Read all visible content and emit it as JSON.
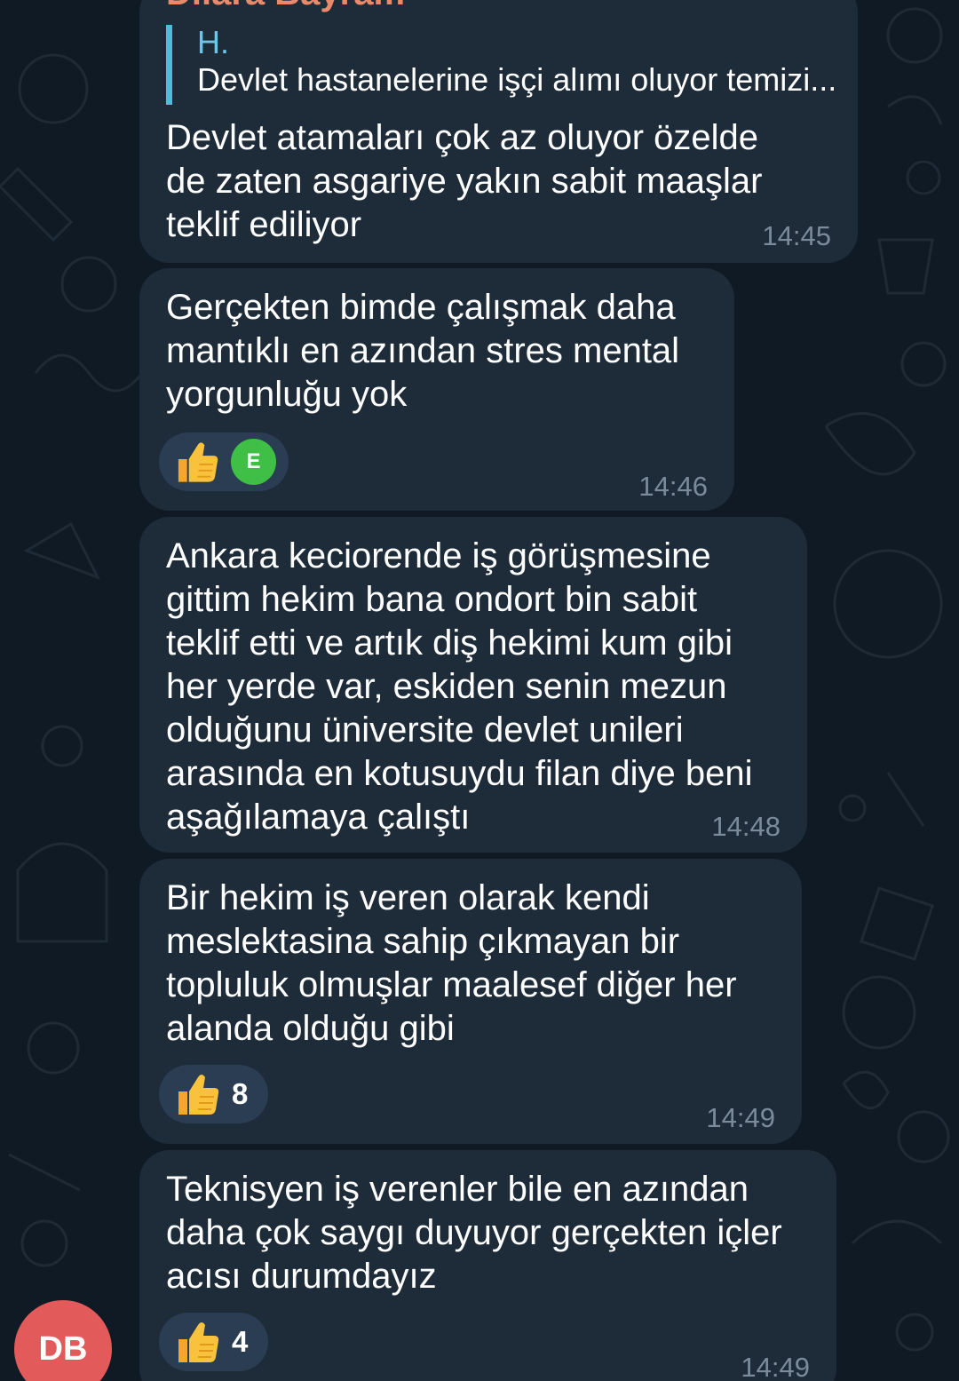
{
  "chat": {
    "sender_name": "Dilara Bayram",
    "avatar_initials": "DB",
    "avatar_color": "#e35a5a",
    "bubble_color": "#1e2c3a",
    "messages": [
      {
        "reply": {
          "author": "H.",
          "text": "Devlet hastanelerine işçi alımı oluyor temizi..."
        },
        "text": "Devlet atamaları çok az oluyor özelde\nde zaten asgariye yakın sabit maaşlar\nteklif ediliyor",
        "time": "14:45"
      },
      {
        "text": "Gerçekten bimde çalışmak daha\nmantıklı en azından stres mental\nyorgunluğu yok",
        "time": "14:46",
        "reaction": {
          "emoji": "thumbs-up-icon",
          "reactor_initial": "E",
          "reactor_color": "#3fbf45"
        }
      },
      {
        "text": "Ankara keciorende iş görüşmesine\ngittim hekim bana ondort bin sabit\nteklif etti ve artık diş hekimi kum gibi\nher yerde var, eskiden senin mezun\nolduğunu üniversite devlet unileri\narasında en kotusuydu filan diye beni\naşağılamaya çalıştı",
        "time": "14:48"
      },
      {
        "text": "Bir hekim iş veren olarak kendi\nmeslektasina sahip çıkmayan bir\ntopluluk olmuşlar maalesef diğer her\nalanda olduğu gibi",
        "time": "14:49",
        "reaction": {
          "emoji": "thumbs-up-icon",
          "count": "8"
        }
      },
      {
        "text": "Teknisyen iş verenler bile en azından\ndaha çok saygı duyuyor gerçekten içler\nacısı durumdayız",
        "time": "14:49",
        "reaction": {
          "emoji": "thumbs-up-icon",
          "count": "4"
        }
      }
    ]
  }
}
